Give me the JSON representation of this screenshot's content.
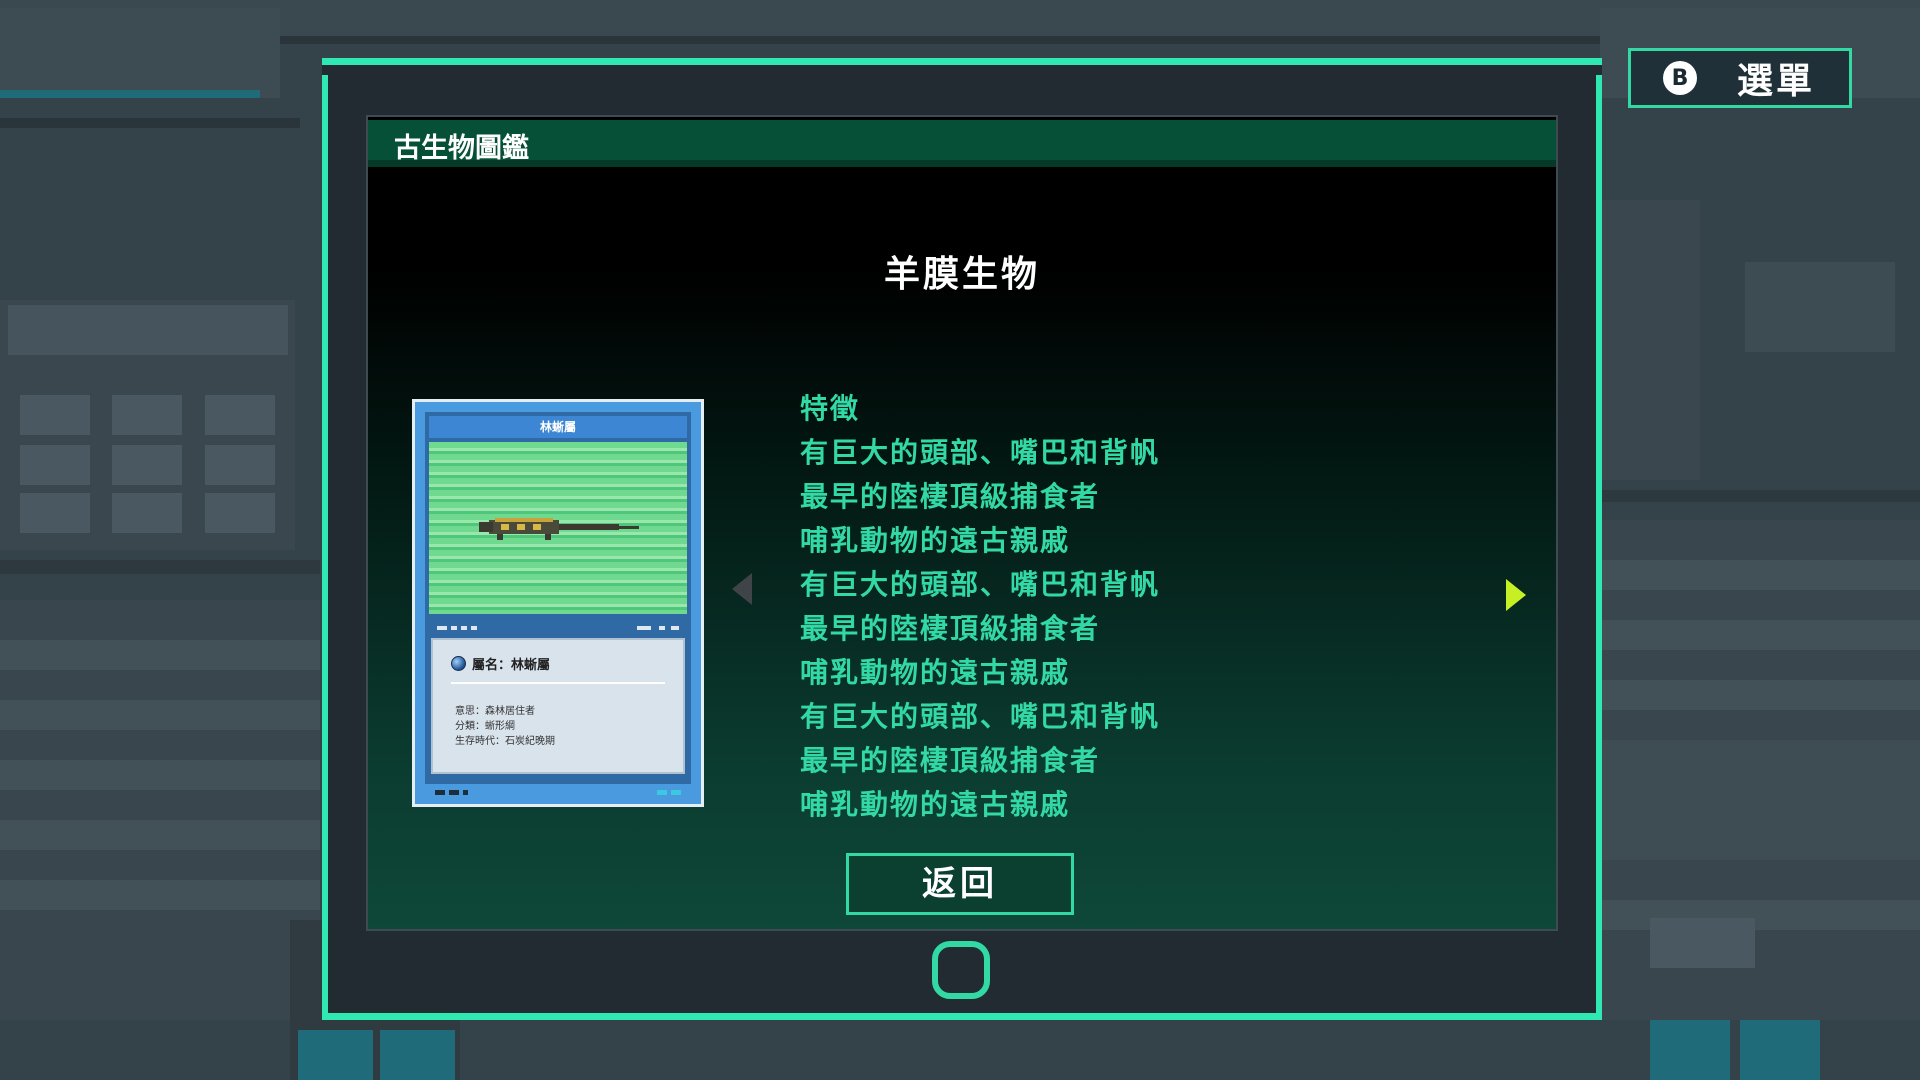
{
  "header": {
    "menu_button": {
      "key": "B",
      "label": "選單"
    }
  },
  "dialog": {
    "title": "古生物圖鑑",
    "entry_title": "羊膜生物",
    "card": {
      "name": "林蜥屬",
      "genus": "屬名：林蜥屬",
      "meaning": "意思：森林居住者",
      "classification": "分類：蜥形綱",
      "era": "生存時代：石炭紀晚期"
    },
    "traits": [
      "特徵",
      "有巨大的頭部、嘴巴和背帆",
      "最早的陸棲頂級捕食者",
      "哺乳動物的遠古親戚",
      "有巨大的頭部、嘴巴和背帆",
      "最早的陸棲頂級捕食者",
      "哺乳動物的遠古親戚",
      "有巨大的頭部、嘴巴和背帆",
      "最早的陸棲頂級捕食者",
      "哺乳動物的遠古親戚"
    ],
    "back_button": "返回"
  },
  "colors": {
    "accent": "#2fe8b2",
    "trait_text": "#33d9a5",
    "next_arrow": "#c6f024",
    "prev_arrow_disabled": "#3e4448"
  },
  "icons": {
    "prev": "caret-left-icon",
    "next": "caret-right-icon",
    "loading": "loading-ring-icon",
    "b_key": "b-button-icon"
  }
}
